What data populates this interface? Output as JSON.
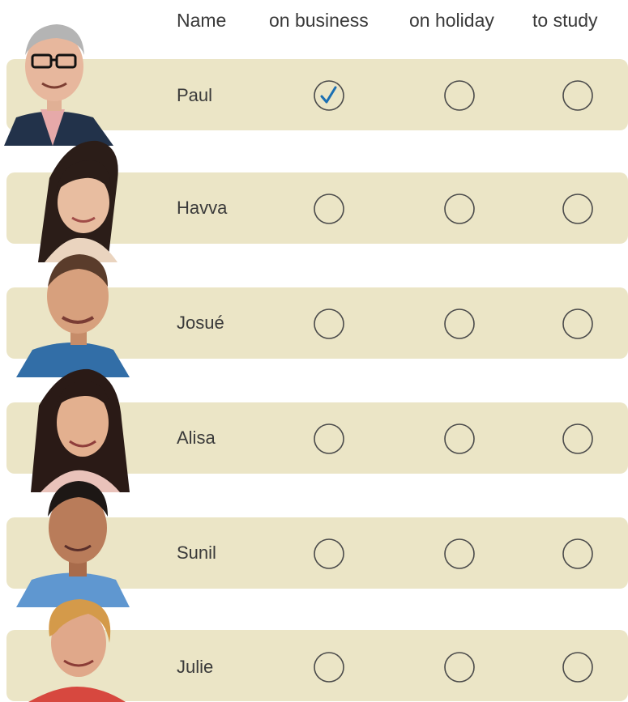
{
  "header": {
    "name_label": "Name",
    "columns": [
      "on business",
      "on holiday",
      "to study"
    ]
  },
  "rows": [
    {
      "name": "Paul",
      "selected": "on business",
      "avatar": "man-glasses-portrait"
    },
    {
      "name": "Havva",
      "selected": "",
      "avatar": "woman-bangs-portrait"
    },
    {
      "name": "Josué",
      "selected": "",
      "avatar": "man-short-hair-portrait"
    },
    {
      "name": "Alisa",
      "selected": "",
      "avatar": "woman-long-hair-portrait"
    },
    {
      "name": "Sunil",
      "selected": "",
      "avatar": "man-dark-hair-portrait"
    },
    {
      "name": "Julie",
      "selected": "",
      "avatar": "woman-short-blonde-portrait"
    }
  ],
  "colors": {
    "band": "#ebe5c6",
    "check": "#1b6fb3",
    "circle": "#4a4a4a"
  },
  "icons": {
    "radio_unchecked": "circle-icon",
    "radio_checked": "check-circle-icon"
  }
}
